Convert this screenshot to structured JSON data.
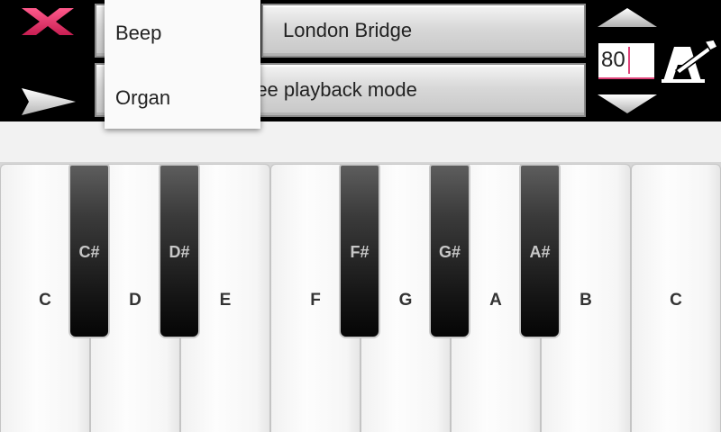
{
  "toolbar": {
    "song_title": "London Bridge",
    "mode_label": "ree playback mode",
    "tempo_value": "80"
  },
  "instrument_menu": {
    "options": [
      "Beep",
      "Organ"
    ]
  },
  "icons": {
    "close": "close-x-icon",
    "play": "play-icon",
    "tempo_up": "arrow-up-icon",
    "tempo_down": "arrow-down-icon",
    "metronome": "metronome-icon"
  },
  "colors": {
    "accent": "#e0447a",
    "background": "#000000",
    "strip": "#f2f2f2"
  },
  "keyboard": {
    "white_keys": [
      "C",
      "D",
      "E",
      "F",
      "G",
      "A",
      "B",
      "C"
    ],
    "black_keys": [
      "C#",
      "D#",
      "F#",
      "G#",
      "A#"
    ]
  }
}
